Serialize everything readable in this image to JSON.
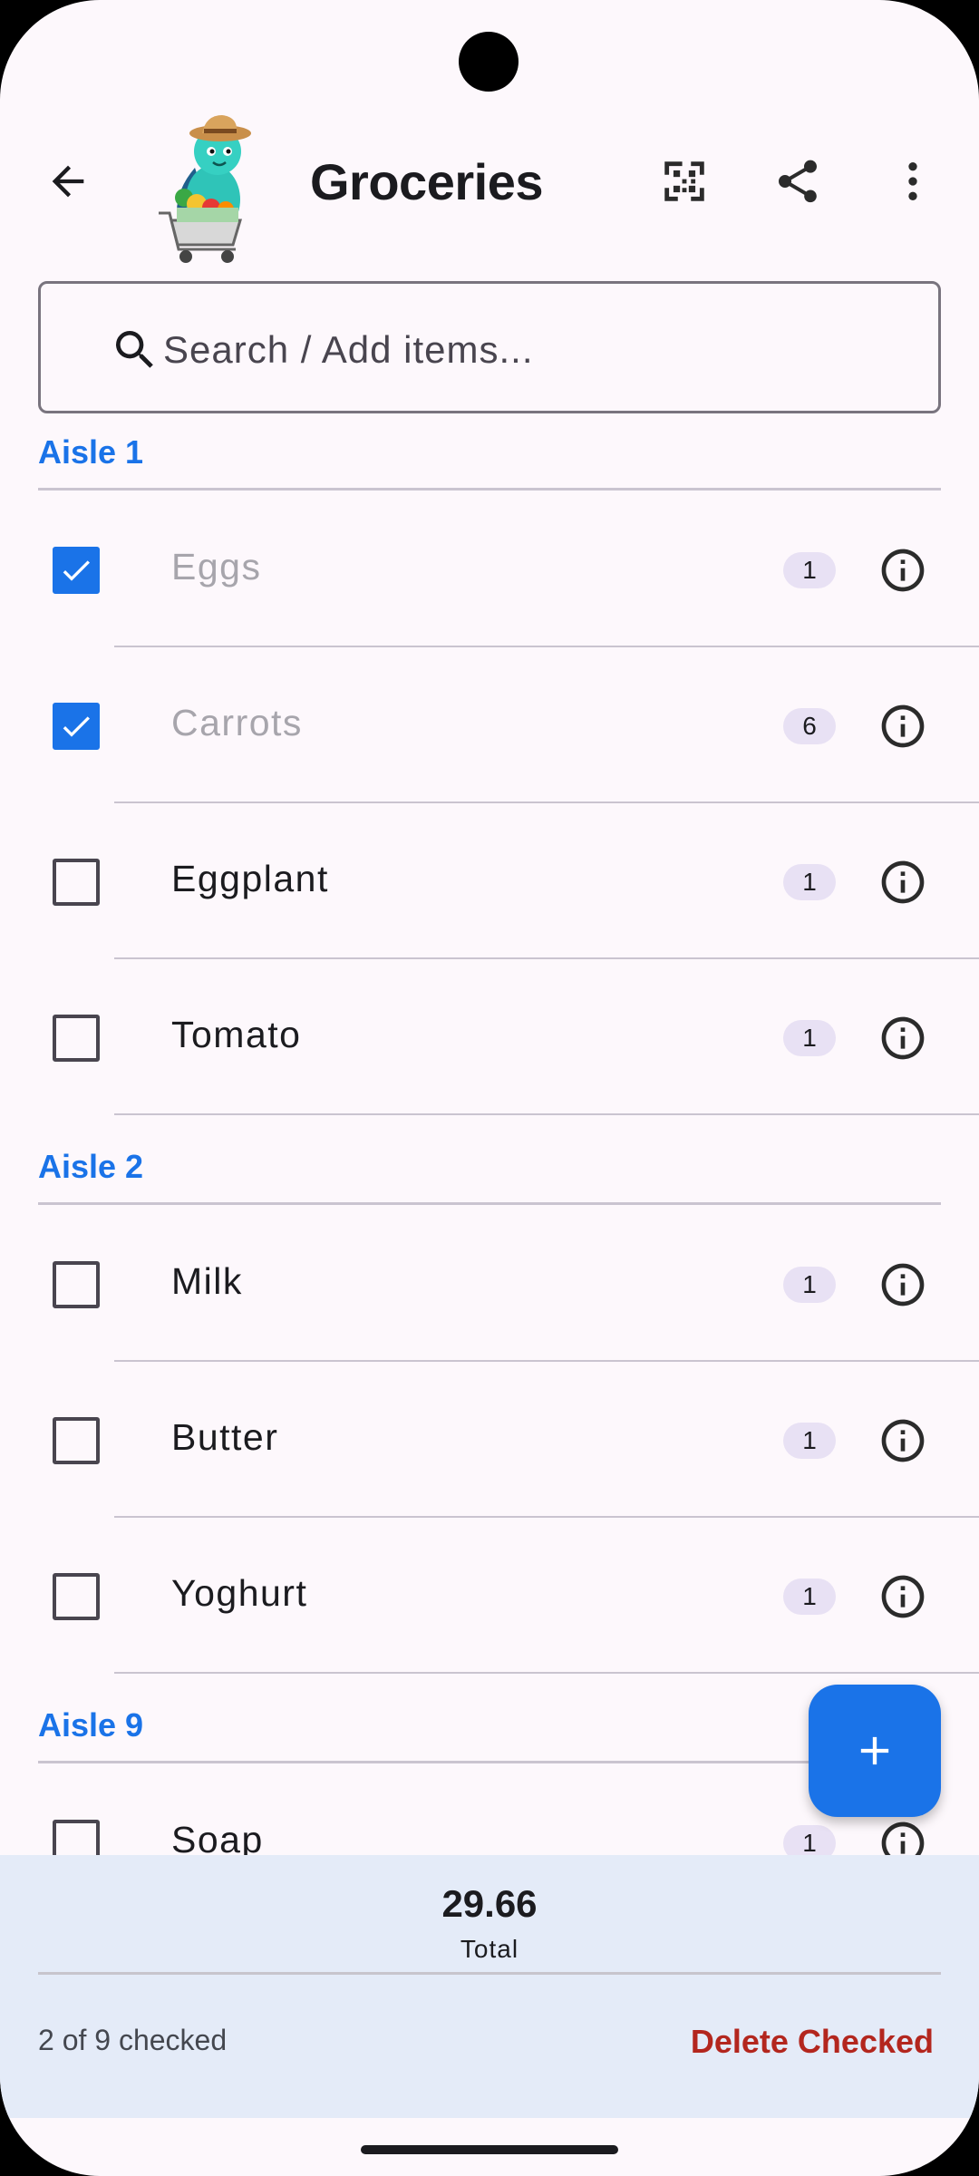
{
  "app": {
    "title": "Groceries",
    "accent_color": "#1a73e8",
    "delete_color": "#b3261e"
  },
  "toolbar": {
    "back_icon": "arrow-back-icon",
    "mascot": "shopping-mascot",
    "qr_icon": "qr-code-icon",
    "share_icon": "share-icon",
    "more_icon": "more-vert-icon"
  },
  "search": {
    "placeholder": "Search / Add items...",
    "value": ""
  },
  "aisles": [
    {
      "name": "Aisle 1",
      "items": [
        {
          "name": "Eggs",
          "qty": "1",
          "checked": true
        },
        {
          "name": "Carrots",
          "qty": "6",
          "checked": true
        },
        {
          "name": "Eggplant",
          "qty": "1",
          "checked": false
        },
        {
          "name": "Tomato",
          "qty": "1",
          "checked": false
        }
      ]
    },
    {
      "name": "Aisle 2",
      "items": [
        {
          "name": "Milk",
          "qty": "1",
          "checked": false
        },
        {
          "name": "Butter",
          "qty": "1",
          "checked": false
        },
        {
          "name": "Yoghurt",
          "qty": "1",
          "checked": false
        }
      ]
    },
    {
      "name": "Aisle 9",
      "items": [
        {
          "name": "Soap",
          "qty": "1",
          "checked": false
        }
      ]
    }
  ],
  "footer": {
    "total_value": "29.66",
    "total_label": "Total",
    "checked_summary": "2 of 9 checked",
    "delete_label": "Delete Checked"
  },
  "fab": {
    "icon": "add-icon"
  }
}
